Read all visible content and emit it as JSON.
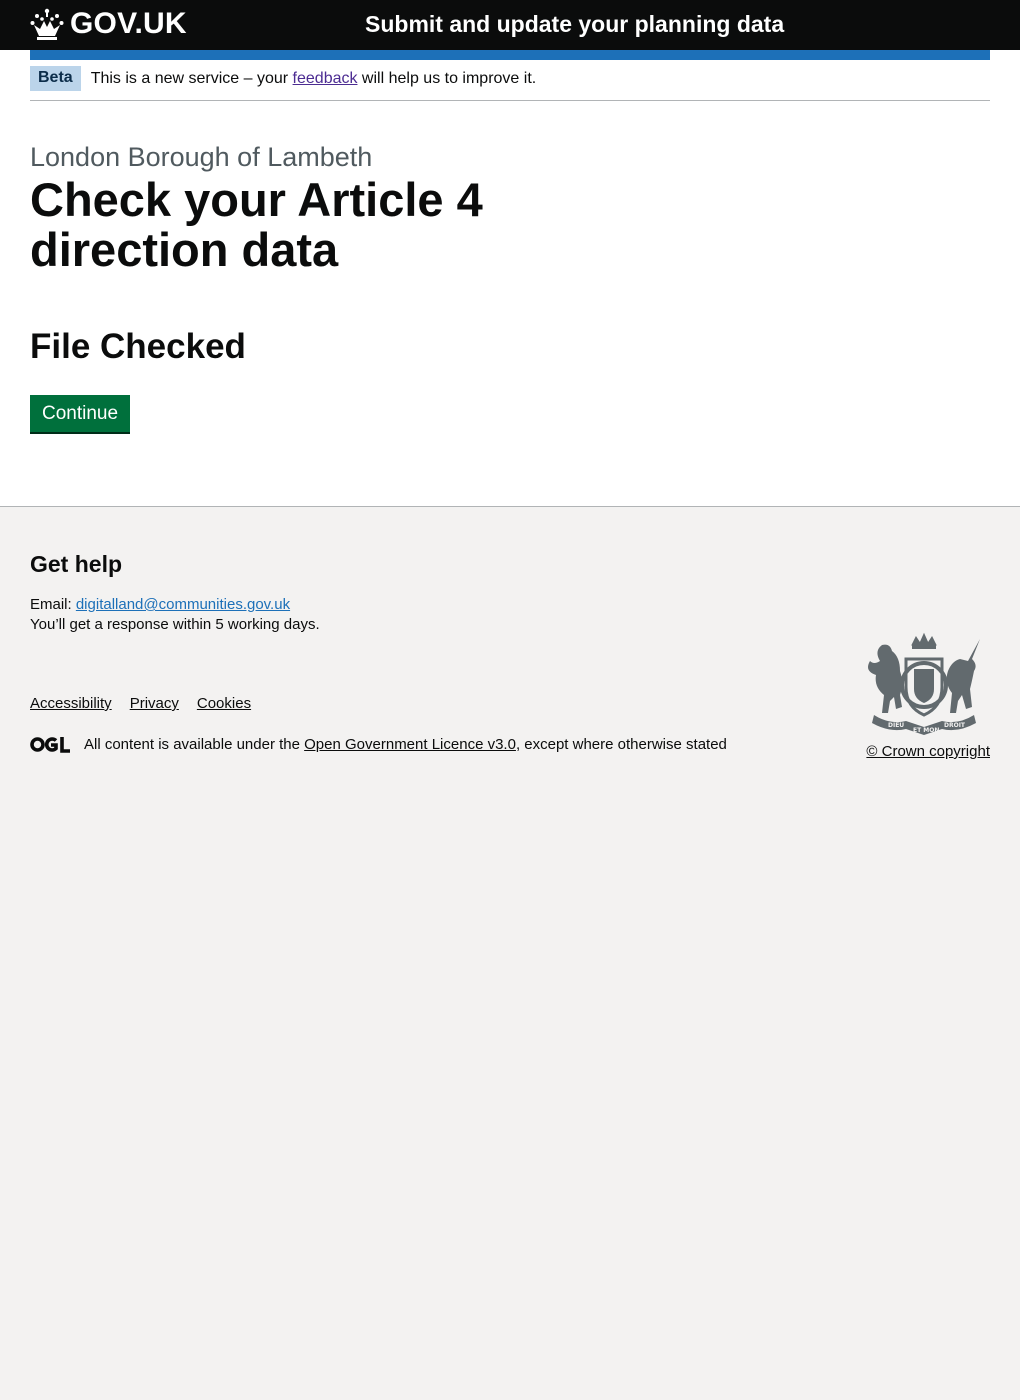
{
  "header": {
    "logo_text": "GOV.UK",
    "service_name": "Submit and update your planning data",
    "accent_color": "#1d70b8"
  },
  "phase_banner": {
    "tag": "Beta",
    "text_before": "This is a new service – your ",
    "link": "feedback",
    "text_after": " will help us to improve it."
  },
  "main": {
    "caption": "London Borough of Lambeth",
    "title": "Check your Article 4 direction data",
    "subheading": "File Checked",
    "continue_label": "Continue",
    "button_color": "#00703c"
  },
  "footer": {
    "heading": "Get help",
    "email_label": "Email: ",
    "email": "digitalland@communities.gov.uk",
    "response_text": "You’ll get a response within 5 working days.",
    "links": [
      "Accessibility",
      "Privacy",
      "Cookies"
    ],
    "licence_before": "All content is available under the ",
    "licence_link": "Open Government Licence v3.0",
    "licence_after": ", except where otherwise stated",
    "copyright": "© Crown copyright",
    "crest_text": [
      "DIEU",
      "ET MON",
      "DROIT"
    ]
  },
  "icons": {
    "logo": "crown-icon",
    "licence": "ogl-logo-icon",
    "crest": "royal-coat-of-arms-icon"
  }
}
